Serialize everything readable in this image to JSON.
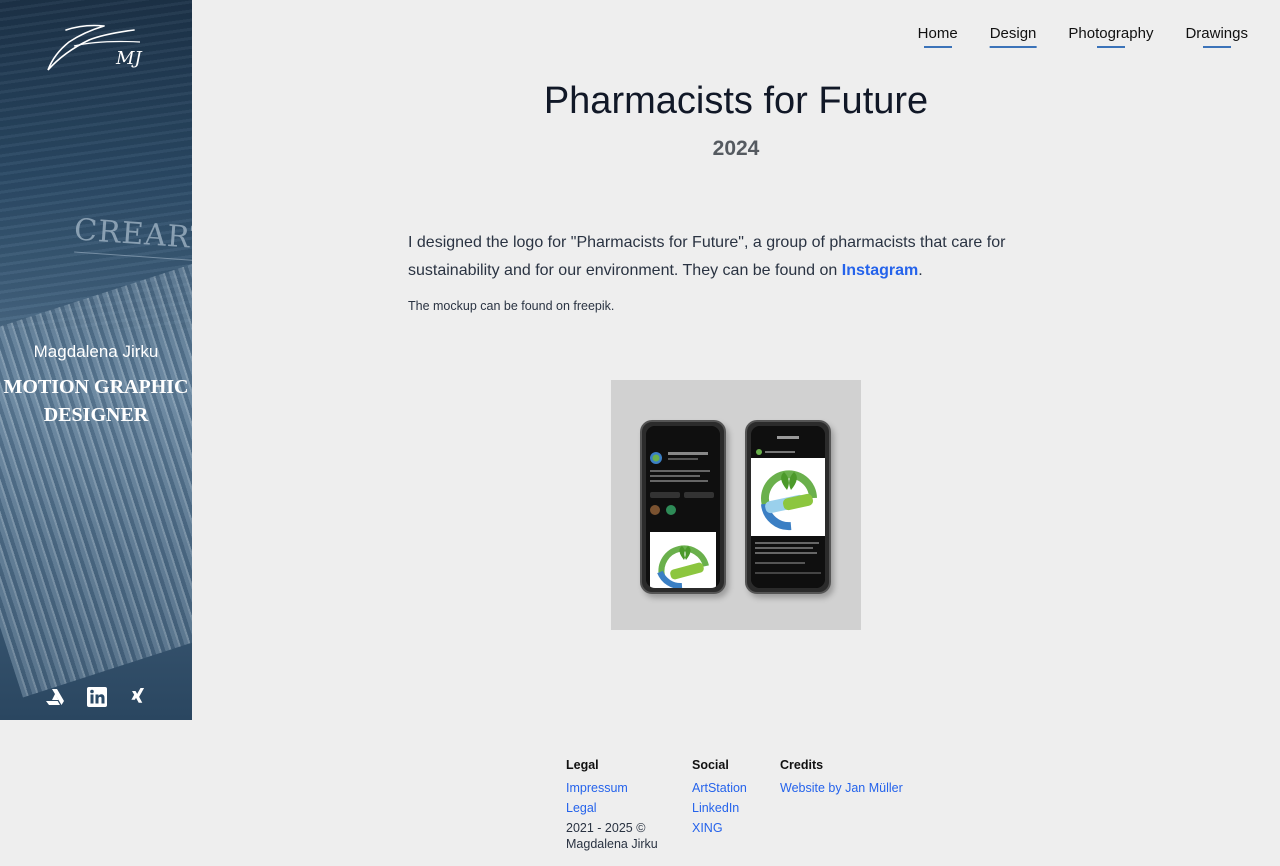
{
  "sidebar": {
    "logo_text": "MJ",
    "name": "Magdalena Jirku",
    "role": "Motion Graphic Designer",
    "background_text": "CREARTE",
    "social": [
      {
        "icon": "artstation-icon"
      },
      {
        "icon": "linkedin-icon"
      },
      {
        "icon": "xing-icon"
      }
    ]
  },
  "nav": {
    "items": [
      {
        "label": "Home"
      },
      {
        "label": "Design",
        "active": true
      },
      {
        "label": "Photography"
      },
      {
        "label": "Drawings"
      }
    ]
  },
  "main": {
    "title": "Pharmacists for Future",
    "year": "2024",
    "description_before": "I designed the logo for \"Pharmacists for Future\", a group of pharmacists that care for sustainability and for our environment. They can be found on ",
    "description_link": "Instagram",
    "description_after": ".",
    "note": "The mockup can be found on freepik."
  },
  "footer": {
    "legal": {
      "heading": "Legal",
      "links": [
        "Impressum",
        "Legal"
      ],
      "copyright": "2021 - 2025 © Magdalena Jirku"
    },
    "social": {
      "heading": "Social",
      "links": [
        "ArtStation",
        "LinkedIn",
        "XING"
      ]
    },
    "credits": {
      "heading": "Credits",
      "links": [
        "Website by Jan Müller"
      ]
    }
  },
  "colors": {
    "accent": "#3b73b9",
    "link": "#2563eb",
    "background": "#eeeeee"
  }
}
